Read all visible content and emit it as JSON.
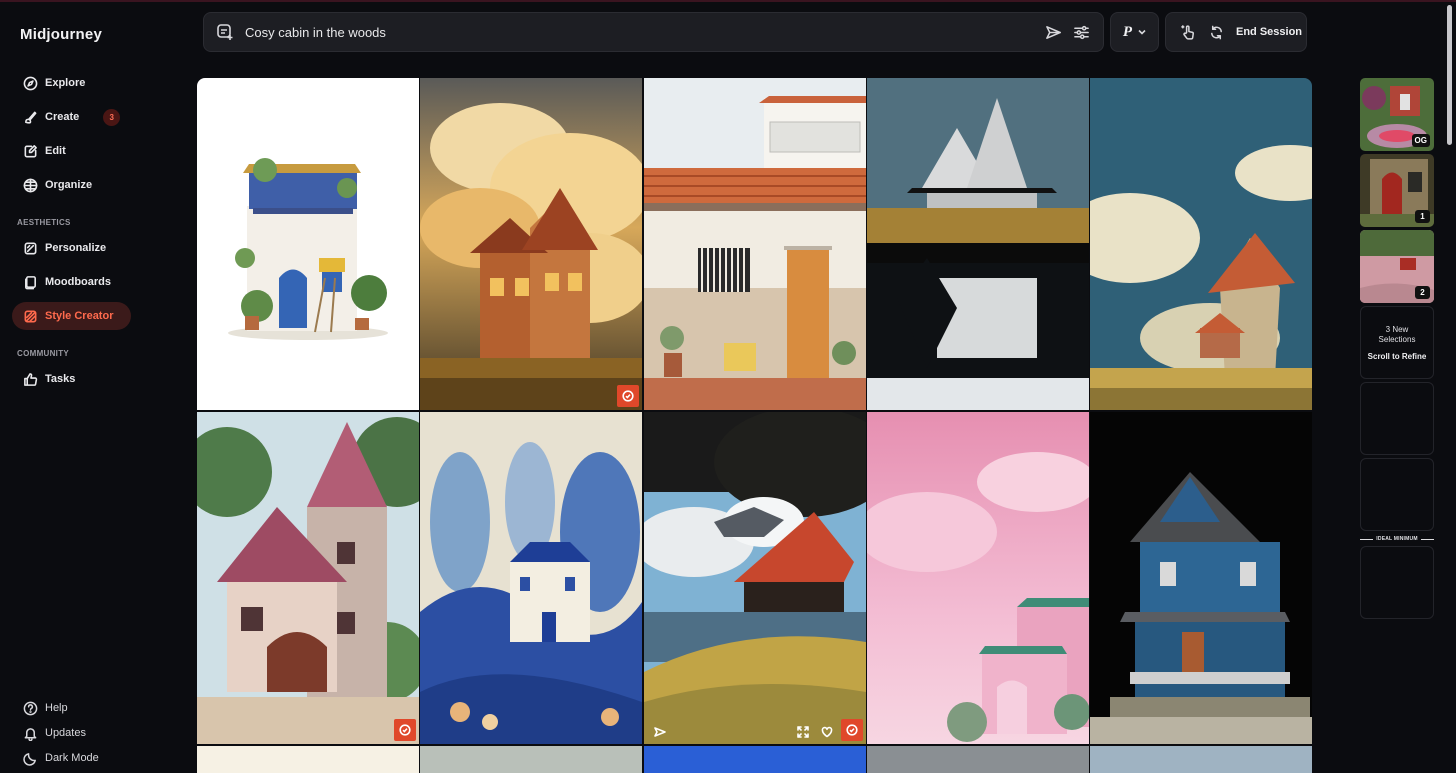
{
  "app": {
    "brand": "Midjourney"
  },
  "sidebar": {
    "nav": [
      {
        "label": "Explore",
        "icon": "compass-icon"
      },
      {
        "label": "Create",
        "icon": "brush-icon",
        "badge": "3"
      },
      {
        "label": "Edit",
        "icon": "edit-icon"
      },
      {
        "label": "Organize",
        "icon": "grid-icon"
      }
    ],
    "aesthetics_label": "AESTHETICS",
    "aesthetics": [
      {
        "label": "Personalize",
        "icon": "personalize-icon"
      },
      {
        "label": "Moodboards",
        "icon": "moodboard-icon"
      },
      {
        "label": "Style Creator",
        "icon": "style-creator-icon",
        "active": true
      }
    ],
    "community_label": "COMMUNITY",
    "community": [
      {
        "label": "Tasks",
        "icon": "thumbs-up-icon"
      }
    ],
    "bottom": [
      {
        "label": "Help",
        "icon": "help-icon"
      },
      {
        "label": "Updates",
        "icon": "bell-icon"
      },
      {
        "label": "Dark Mode",
        "icon": "moon-icon"
      }
    ]
  },
  "prompt": {
    "value": "Cosy cabin in the woods"
  },
  "toolbar": {
    "personalize_letter": "P",
    "end_session": "End Session"
  },
  "rail": {
    "thumbs": [
      {
        "tag": "OG"
      },
      {
        "tag": "1"
      },
      {
        "tag": "2"
      }
    ],
    "new_selections": "3 New Selections",
    "scroll_to_refine": "Scroll to Refine",
    "ideal_minimum": "IDEAL MINIMUM"
  },
  "colors": {
    "accent": "#e0482a",
    "active_bg": "#3b1a1a",
    "background": "#0b0c10",
    "panel": "#1d1e23"
  }
}
